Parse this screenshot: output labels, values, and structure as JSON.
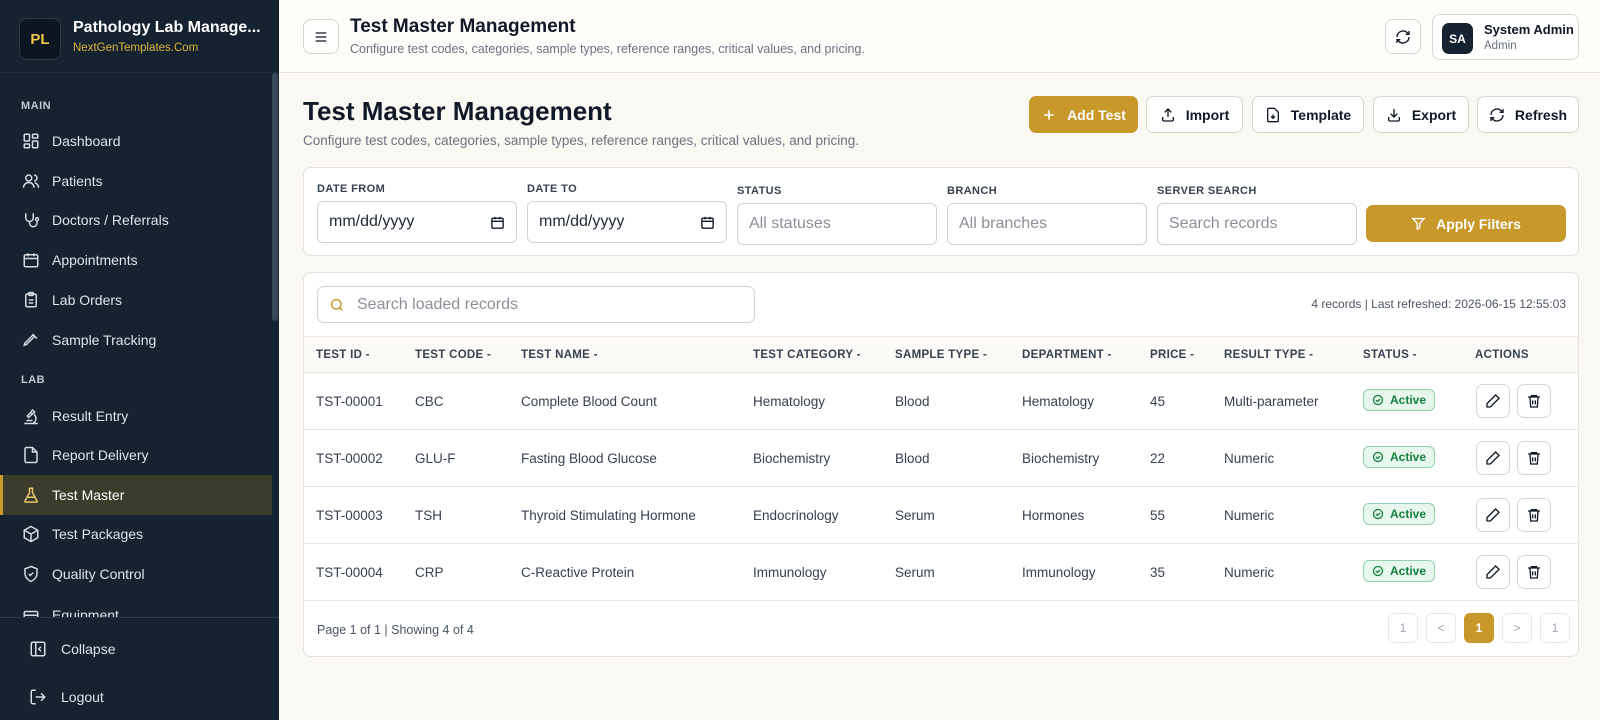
{
  "brand": {
    "logo": "PL",
    "title": "Pathology Lab Manage...",
    "subtitle": "NextGenTemplates.Com"
  },
  "sidebar": {
    "sections": {
      "main": "MAIN",
      "lab": "LAB"
    },
    "main_items": [
      {
        "label": "Dashboard",
        "icon": "dashboard-icon"
      },
      {
        "label": "Patients",
        "icon": "users-icon"
      },
      {
        "label": "Doctors / Referrals",
        "icon": "stethoscope-icon"
      },
      {
        "label": "Appointments",
        "icon": "calendar-icon"
      },
      {
        "label": "Lab Orders",
        "icon": "clipboard-icon"
      },
      {
        "label": "Sample Tracking",
        "icon": "pipette-icon"
      }
    ],
    "lab_items": [
      {
        "label": "Result Entry",
        "icon": "microscope-icon"
      },
      {
        "label": "Report Delivery",
        "icon": "file-icon"
      },
      {
        "label": "Test Master",
        "icon": "flask-icon",
        "active": true
      },
      {
        "label": "Test Packages",
        "icon": "package-icon"
      },
      {
        "label": "Quality Control",
        "icon": "shield-icon"
      },
      {
        "label": "Equipment",
        "icon": "equipment-icon"
      }
    ],
    "footer": {
      "collapse": "Collapse",
      "logout": "Logout"
    }
  },
  "topbar": {
    "title": "Test Master Management",
    "subtitle": "Configure test codes, categories, sample types, reference ranges, critical values, and pricing.",
    "user": {
      "initials": "SA",
      "name": "System Admin",
      "role": "Admin"
    }
  },
  "page": {
    "title": "Test Master Management",
    "subtitle": "Configure test codes, categories, sample types, reference ranges, critical values, and pricing.",
    "actions": {
      "add": "Add Test",
      "import": "Import",
      "template": "Template",
      "export": "Export",
      "refresh": "Refresh"
    }
  },
  "filters": {
    "date_from_label": "DATE FROM",
    "date_from_value": "mm/dd/yyyy",
    "date_to_label": "DATE TO",
    "date_to_value": "mm/dd/yyyy",
    "status_label": "STATUS",
    "status_placeholder": "All statuses",
    "branch_label": "BRANCH",
    "branch_placeholder": "All branches",
    "search_label": "SERVER SEARCH",
    "search_placeholder": "Search records",
    "apply": "Apply Filters"
  },
  "table": {
    "search_placeholder": "Search loaded records",
    "records_info": "4 records | Last refreshed: 2026-06-15 12:55:03",
    "columns": [
      "TEST ID",
      "TEST CODE",
      "TEST NAME",
      "TEST CATEGORY",
      "SAMPLE TYPE",
      "DEPARTMENT",
      "PRICE",
      "RESULT TYPE",
      "STATUS",
      "ACTIONS"
    ],
    "rows": [
      {
        "id": "TST-00001",
        "code": "CBC",
        "name": "Complete Blood Count",
        "category": "Hematology",
        "sample": "Blood",
        "department": "Hematology",
        "price": "45",
        "result_type": "Multi-parameter",
        "status": "Active"
      },
      {
        "id": "TST-00002",
        "code": "GLU-F",
        "name": "Fasting Blood Glucose",
        "category": "Biochemistry",
        "sample": "Blood",
        "department": "Biochemistry",
        "price": "22",
        "result_type": "Numeric",
        "status": "Active"
      },
      {
        "id": "TST-00003",
        "code": "TSH",
        "name": "Thyroid Stimulating Hormone",
        "category": "Endocrinology",
        "sample": "Serum",
        "department": "Hormones",
        "price": "55",
        "result_type": "Numeric",
        "status": "Active"
      },
      {
        "id": "TST-00004",
        "code": "CRP",
        "name": "C-Reactive Protein",
        "category": "Immunology",
        "sample": "Serum",
        "department": "Immunology",
        "price": "35",
        "result_type": "Numeric",
        "status": "Active"
      }
    ],
    "footer": "Page 1 of 1 | Showing 4 of 4",
    "pagination": [
      "1",
      "<",
      "1",
      ">",
      "1"
    ]
  },
  "colors": {
    "accent": "#c9982a",
    "sidebar_bg": "#15222f",
    "active_badge": "#15803d"
  }
}
